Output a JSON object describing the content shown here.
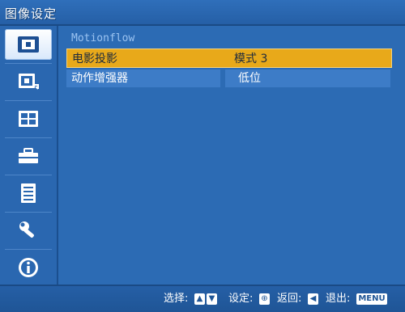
{
  "window": {
    "title": "图像设定"
  },
  "sidebar": {
    "items": [
      {
        "icon": "picture-icon",
        "selected": true
      },
      {
        "icon": "picture-adjust-icon",
        "selected": false
      },
      {
        "icon": "screen-layout-icon",
        "selected": false
      },
      {
        "icon": "toolbox-icon",
        "selected": false
      },
      {
        "icon": "list-icon",
        "selected": false
      },
      {
        "icon": "wrench-icon",
        "selected": false
      },
      {
        "icon": "info-icon",
        "selected": false
      }
    ]
  },
  "main": {
    "section_title": "Motionflow",
    "rows": [
      {
        "label": "电影投影",
        "value": "模式 3",
        "active": true
      },
      {
        "label": "动作增强器",
        "value": "低位",
        "active": false
      }
    ]
  },
  "footer": {
    "select_label": "选择:",
    "set_label": "设定:",
    "back_label": "返回:",
    "exit_label": "退出:",
    "menu_key": "MENU"
  },
  "colors": {
    "background": "#2c6bb4",
    "highlight": "#e8a91a",
    "row": "#3d7cc7",
    "section": "#9cc4f2"
  }
}
